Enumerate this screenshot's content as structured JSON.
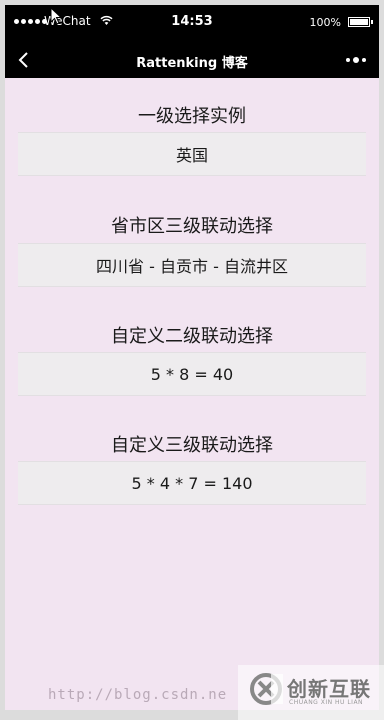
{
  "status_bar": {
    "carrier": "WeChat",
    "time": "14:53",
    "battery": "100%"
  },
  "nav": {
    "title": "Rattenking 博客"
  },
  "sections": [
    {
      "label": "一级选择实例",
      "value": "英国"
    },
    {
      "label": "省市区三级联动选择",
      "value": "四川省 - 自贡市 - 自流井区"
    },
    {
      "label": "自定义二级联动选择",
      "value": "5 * 8 = 40"
    },
    {
      "label": "自定义三级联动选择",
      "value": "5 * 4 * 7 = 140"
    }
  ],
  "watermark": {
    "url": "http://blog.csdn.ne",
    "logo_text": "创新互联",
    "logo_sub": "CHUANG XIN HU LIAN"
  },
  "colors": {
    "page_background": "#f2e4f1",
    "bar_background": "#000000",
    "picker_background": "#eeecee"
  }
}
